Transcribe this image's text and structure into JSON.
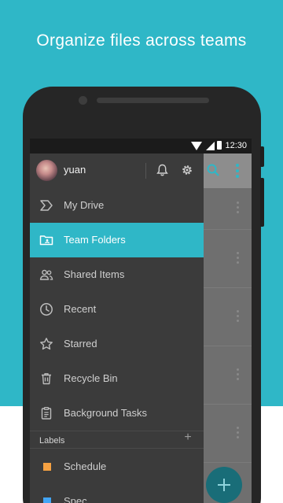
{
  "promo": {
    "headline": "Organize files across teams"
  },
  "status_bar": {
    "time": "12:30"
  },
  "drawer": {
    "user": {
      "name": "yuan"
    },
    "nav_items": [
      {
        "label": "My Drive",
        "icon": "drive-icon"
      },
      {
        "label": "Team Folders",
        "icon": "team-folder-icon",
        "active": true
      },
      {
        "label": "Shared Items",
        "icon": "people-icon"
      },
      {
        "label": "Recent",
        "icon": "clock-icon"
      },
      {
        "label": "Starred",
        "icon": "star-icon"
      },
      {
        "label": "Recycle Bin",
        "icon": "trash-icon"
      },
      {
        "label": "Background Tasks",
        "icon": "clipboard-icon"
      }
    ],
    "labels_section": {
      "title": "Labels",
      "add_symbol": "+",
      "items": [
        {
          "label": "Schedule",
          "color": "#f5a142"
        },
        {
          "label": "Spec",
          "color": "#42a5f5"
        }
      ]
    }
  },
  "colors": {
    "accent": "#2fb7c7",
    "drawer_bg": "#3b3b3b",
    "fab": "#196d78"
  }
}
